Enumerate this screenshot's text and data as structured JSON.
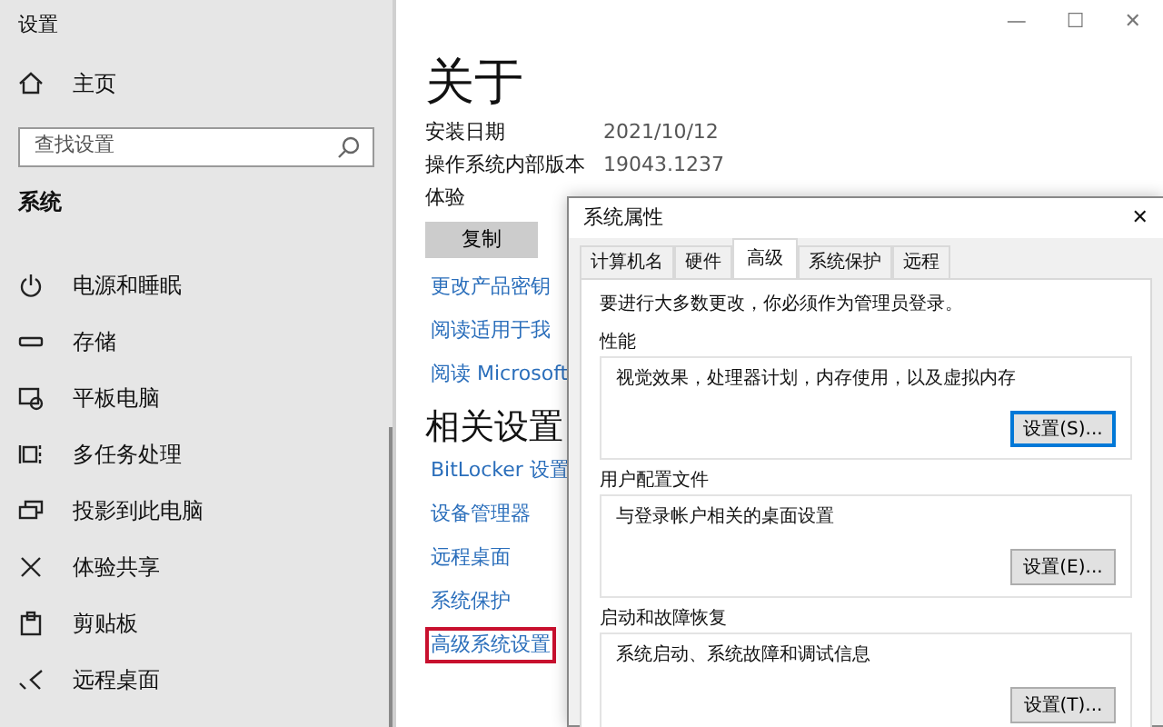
{
  "sidebar": {
    "title": "设置",
    "home": "主页",
    "search": {
      "placeholder": "查找设置"
    },
    "section": "系统",
    "items": [
      {
        "label": "电源和睡眠",
        "kind": "power"
      },
      {
        "label": "存储",
        "kind": "storage"
      },
      {
        "label": "平板电脑",
        "kind": "tablet"
      },
      {
        "label": "多任务处理",
        "kind": "multitask"
      },
      {
        "label": "投影到此电脑",
        "kind": "project"
      },
      {
        "label": "体验共享",
        "kind": "shared"
      },
      {
        "label": "剪贴板",
        "kind": "clipboard"
      },
      {
        "label": "远程桌面",
        "kind": "remote"
      }
    ]
  },
  "window_controls": [
    "—",
    "☐",
    "✕"
  ],
  "main": {
    "heading": "关于",
    "specs": [
      {
        "label": "安装日期",
        "value": "2021/10/12"
      },
      {
        "label": "操作系统内部版本",
        "value": "19043.1237"
      },
      {
        "label": "体验"
      }
    ],
    "copy_button": "复制",
    "links": [
      "更改产品密钥",
      "阅读适用于我",
      "阅读 Microsoft"
    ],
    "related_heading": "相关设置",
    "related_links": [
      {
        "label": "BitLocker 设置",
        "highlighted": false
      },
      {
        "label": "设备管理器",
        "highlighted": false
      },
      {
        "label": "远程桌面",
        "highlighted": false
      },
      {
        "label": "系统保护",
        "highlighted": false
      },
      {
        "label": "高级系统设置",
        "highlighted": true
      }
    ]
  },
  "dialog": {
    "title": "系统属性",
    "close": "✕",
    "tabs": [
      {
        "label": "计算机名",
        "selected": false
      },
      {
        "label": "硬件",
        "selected": false
      },
      {
        "label": "高级",
        "selected": true
      },
      {
        "label": "系统保护",
        "selected": false
      },
      {
        "label": "远程",
        "selected": false
      }
    ],
    "note": "要进行大多数更改，你必须作为管理员登录。",
    "groups": [
      {
        "title": "性能",
        "description": "视觉效果，处理器计划，内存使用，以及虚拟内存",
        "button": "设置(S)...",
        "default": true
      },
      {
        "title": "用户配置文件",
        "description": "与登录帐户相关的桌面设置",
        "button": "设置(E)...",
        "default": false
      },
      {
        "title": "启动和故障恢复",
        "description": "系统启动、系统故障和调试信息",
        "button": "设置(T)...",
        "default": false
      }
    ]
  }
}
